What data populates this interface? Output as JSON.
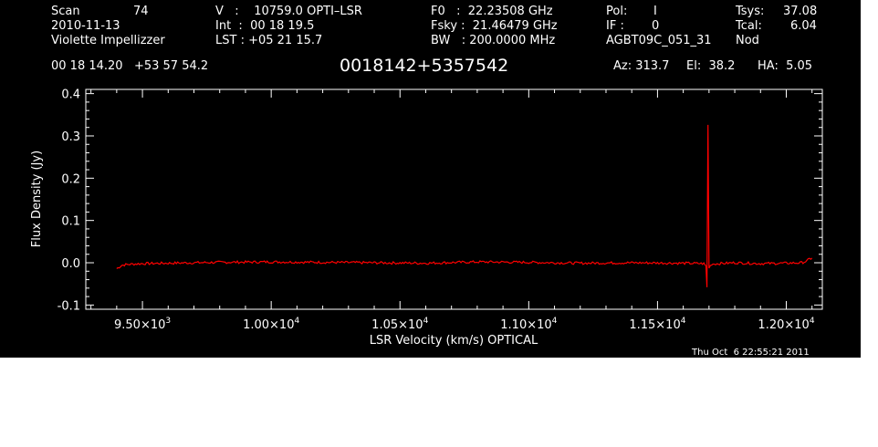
{
  "header": {
    "scan_label": "Scan",
    "scan_number": "74",
    "date": "2010-11-13",
    "observer": "Violette Impellizzer",
    "velocity": "V   :    10759.0 OPTI–LSR",
    "integration": "Int  :  00 18 19.5",
    "lst": "LST : +05 21 15.7",
    "f0": "F0   :  22.23508 GHz",
    "fsky": "Fsky :  21.46479 GHz",
    "bw": "BW   : 200.0000 MHz",
    "pol_label": "Pol:",
    "pol_value": "I",
    "if_label": "IF :",
    "if_value": "0",
    "project": "AGBT09C_051_31",
    "tsys_label": "Tsys:",
    "tsys_value": "37.08",
    "tcal_label": "Tcal:",
    "tcal_value": "6.04",
    "mode": "Nod",
    "coordinates": "00 18 14.20   +53 57 54.2",
    "source_name": "0018142+5357542",
    "az": "Az: 313.7",
    "el": "El:  38.2",
    "ha": "HA:  5.05",
    "timestamp": "Thu Oct  6 22:55:21 2011"
  },
  "chart_data": {
    "type": "line",
    "xlabel": "LSR Velocity (km/s) OPTICAL",
    "ylabel": "Flux Density (Jy)",
    "xlim": [
      9280,
      12140
    ],
    "ylim": [
      -0.11,
      0.41
    ],
    "x_ticks": [
      {
        "value": 9500,
        "mantissa": "9.50",
        "exponent": "3"
      },
      {
        "value": 10000,
        "mantissa": "1.00",
        "exponent": "4"
      },
      {
        "value": 10500,
        "mantissa": "1.05",
        "exponent": "4"
      },
      {
        "value": 11000,
        "mantissa": "1.10",
        "exponent": "4"
      },
      {
        "value": 11500,
        "mantissa": "1.15",
        "exponent": "4"
      },
      {
        "value": 12000,
        "mantissa": "1.20",
        "exponent": "4"
      }
    ],
    "y_ticks": [
      {
        "value": -0.1,
        "label": "-0.1"
      },
      {
        "value": 0.0,
        "label": "0.0"
      },
      {
        "value": 0.1,
        "label": "0.1"
      },
      {
        "value": 0.2,
        "label": "0.2"
      },
      {
        "value": 0.3,
        "label": "0.3"
      },
      {
        "value": 0.4,
        "label": "0.4"
      }
    ],
    "series": [
      {
        "color": "#ff0000",
        "x": [
          9400,
          9410,
          9420,
          9440,
          9500,
          9600,
          9800,
          10000,
          10200,
          10400,
          10600,
          10800,
          11000,
          11200,
          11400,
          11600,
          11680,
          11688,
          11692,
          11696,
          11700,
          11710,
          11800,
          11900,
          12000,
          12060,
          12080,
          12090,
          12100
        ],
        "y": [
          -0.014,
          -0.01,
          -0.006,
          -0.004,
          -0.002,
          -0.001,
          0.001,
          0.002,
          0.001,
          0.0,
          -0.001,
          0.002,
          0.001,
          -0.001,
          0.0,
          -0.001,
          -0.002,
          -0.008,
          -0.058,
          0.326,
          -0.012,
          -0.003,
          0.0,
          -0.002,
          -0.001,
          0.0,
          0.004,
          0.009,
          0.011
        ]
      }
    ]
  }
}
